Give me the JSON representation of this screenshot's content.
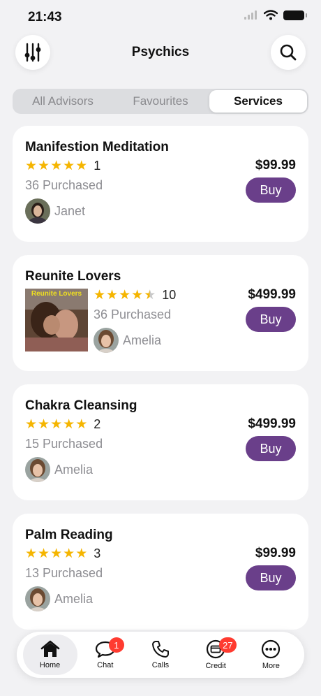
{
  "status": {
    "time": "21:43"
  },
  "header": {
    "title": "Psychics",
    "filter_icon": "sliders-icon",
    "search_icon": "search-icon"
  },
  "segments": [
    {
      "label": "All Advisors",
      "active": false
    },
    {
      "label": "Favourites",
      "active": false
    },
    {
      "label": "Services",
      "active": true
    }
  ],
  "services": [
    {
      "title": "Manifestion Meditation",
      "stars": 5,
      "rating_count": "1",
      "purchased": "36 Purchased",
      "price": "$99.99",
      "buy_label": "Buy",
      "advisor": "Janet"
    },
    {
      "title": "Reunite Lovers",
      "stars": 4.5,
      "rating_count": "10",
      "purchased": "36 Purchased",
      "price": "$499.99",
      "buy_label": "Buy",
      "advisor": "Amelia",
      "thumbnail_label": "Reunite Lovers"
    },
    {
      "title": "Chakra Cleansing",
      "stars": 5,
      "rating_count": "2",
      "purchased": "15 Purchased",
      "price": "$499.99",
      "buy_label": "Buy",
      "advisor": "Amelia"
    },
    {
      "title": "Palm Reading",
      "stars": 5,
      "rating_count": "3",
      "purchased": "13 Purchased",
      "price": "$99.99",
      "buy_label": "Buy",
      "advisor": "Amelia"
    }
  ],
  "tabbar": [
    {
      "label": "Home",
      "icon": "home-icon",
      "active": true,
      "badge": ""
    },
    {
      "label": "Chat",
      "icon": "chat-icon",
      "active": false,
      "badge": "1"
    },
    {
      "label": "Calls",
      "icon": "phone-icon",
      "active": false,
      "badge": ""
    },
    {
      "label": "Credit",
      "icon": "credit-card-icon",
      "active": false,
      "badge": "27"
    },
    {
      "label": "More",
      "icon": "more-icon",
      "active": false,
      "badge": ""
    }
  ],
  "colors": {
    "accent": "#6a3f8a",
    "star": "#f5b500",
    "badge": "#ff3b30"
  }
}
